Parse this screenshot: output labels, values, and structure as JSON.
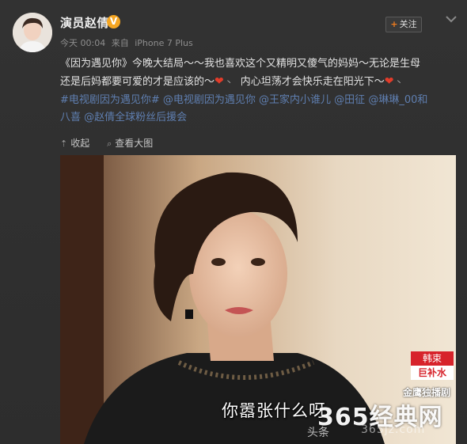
{
  "post": {
    "author": "演员赵倩",
    "verified_mark": "V",
    "time": "今天 00:04",
    "source_prefix": "来自",
    "source": "iPhone 7 Plus",
    "follow_plus": "+",
    "follow_label": "关注",
    "text_line1": "《因为遇见你》今晚大结局～～我也喜欢这个又精明又傻气的妈妈～无论是生母",
    "text_line2_a": "还是后妈都要可爱的才是应该的～",
    "heart_glyph": "❤",
    "emoji_tail": "丶",
    "text_line2_b": "内心坦荡才会快乐走在阳光下～",
    "tags_line1": "#电视剧因为遇见你# @电视剧因为遇见你 @王家内小谁儿 @田征 @琳琳_00和",
    "tags_line2": "八喜 @赵倩全球粉丝后援会"
  },
  "actions": {
    "collapse_label": "收起",
    "view_large_label": "查看大图"
  },
  "photo": {
    "subtitle": "你嚣张什么呀",
    "badge_top": "韩束",
    "badge_bottom": "巨补水",
    "channel_logo": "金鹰独播剧",
    "watermark_main": "365经典网",
    "watermark_small": "头条",
    "watermark_url": "365jz.com"
  },
  "colors": {
    "background": "#2f2f2f",
    "link": "#5f7fb1",
    "verified": "#f5a623",
    "follow_plus": "#f07c1e",
    "heart": "#e23c2a",
    "ad_red": "#d7232b"
  },
  "icons": {
    "more": "chevron-down-icon",
    "collapse": "collapse-arrow-icon",
    "view_large": "magnifier-icon",
    "verified": "verified-badge-icon",
    "heart": "heart-emoji-icon"
  }
}
